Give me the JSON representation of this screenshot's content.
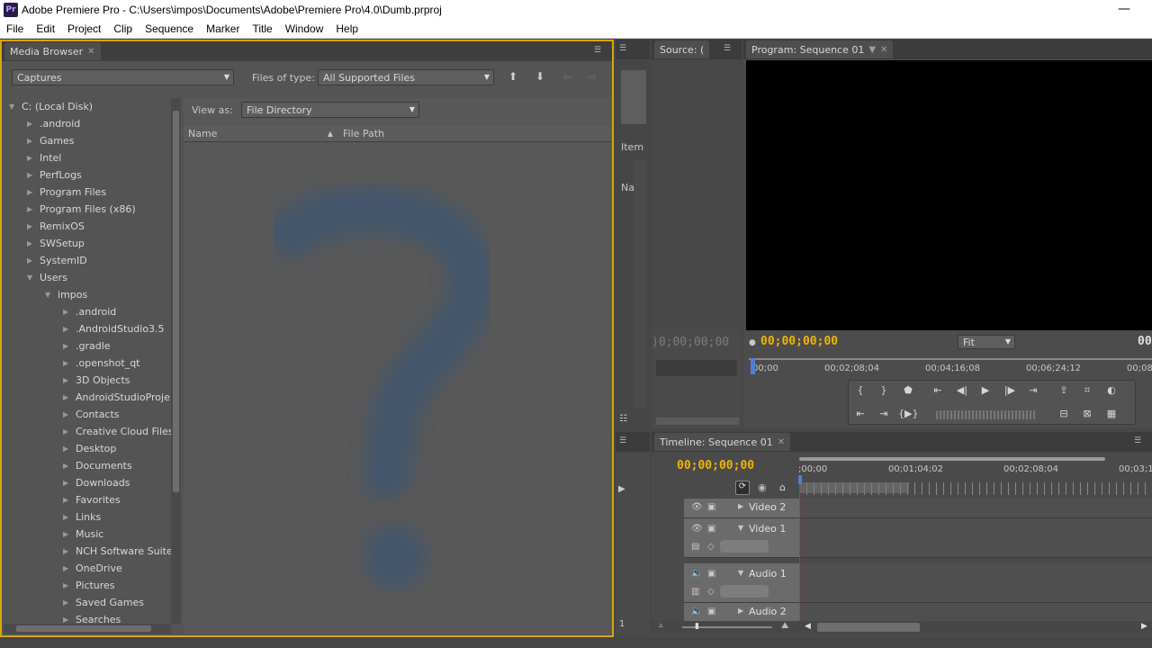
{
  "window": {
    "title": "Adobe Premiere Pro - C:\\Users\\impos\\Documents\\Adobe\\Premiere Pro\\4.0\\Dumb.prproj",
    "app_icon": "Pr",
    "minimize": "—"
  },
  "menu": [
    "File",
    "Edit",
    "Project",
    "Clip",
    "Sequence",
    "Marker",
    "Title",
    "Window",
    "Help"
  ],
  "media_browser": {
    "tab": "Media Browser",
    "location": "Captures",
    "files_of_type_label": "Files of type:",
    "files_of_type_value": "All Supported Files",
    "view_as_label": "View as:",
    "view_as_value": "File Directory",
    "columns": [
      "Name",
      "File Path"
    ],
    "tree": [
      {
        "label": "C: (Local Disk)",
        "level": 0,
        "expanded": true
      },
      {
        "label": ".android",
        "level": 1
      },
      {
        "label": "Games",
        "level": 1
      },
      {
        "label": "Intel",
        "level": 1
      },
      {
        "label": "PerfLogs",
        "level": 1
      },
      {
        "label": "Program Files",
        "level": 1
      },
      {
        "label": "Program Files (x86)",
        "level": 1
      },
      {
        "label": "RemixOS",
        "level": 1
      },
      {
        "label": "SWSetup",
        "level": 1
      },
      {
        "label": "SystemID",
        "level": 1
      },
      {
        "label": "Users",
        "level": 1,
        "expanded": true
      },
      {
        "label": "impos",
        "level": 2,
        "expanded": true
      },
      {
        "label": ".android",
        "level": 3
      },
      {
        "label": ".AndroidStudio3.5",
        "level": 3
      },
      {
        "label": ".gradle",
        "level": 3
      },
      {
        "label": ".openshot_qt",
        "level": 3
      },
      {
        "label": "3D Objects",
        "level": 3
      },
      {
        "label": "AndroidStudioProje",
        "level": 3
      },
      {
        "label": "Contacts",
        "level": 3
      },
      {
        "label": "Creative Cloud Files",
        "level": 3
      },
      {
        "label": "Desktop",
        "level": 3
      },
      {
        "label": "Documents",
        "level": 3
      },
      {
        "label": "Downloads",
        "level": 3
      },
      {
        "label": "Favorites",
        "level": 3
      },
      {
        "label": "Links",
        "level": 3
      },
      {
        "label": "Music",
        "level": 3
      },
      {
        "label": "NCH Software Suite",
        "level": 3
      },
      {
        "label": "OneDrive",
        "level": 3
      },
      {
        "label": "Pictures",
        "level": 3
      },
      {
        "label": "Saved Games",
        "level": 3
      },
      {
        "label": "Searches",
        "level": 3
      }
    ]
  },
  "project": {
    "item_label": "Item",
    "name_label": "Na",
    "count": "1"
  },
  "source": {
    "tab": "Source: (",
    "timecode": ")0;00;00;00"
  },
  "program": {
    "tab": "Program: Sequence 01",
    "timecode": "00;00;00;00",
    "fit": "Fit",
    "right_timecode": "00",
    "ruler_labels": [
      "00;00",
      "00;02;08;04",
      "00;04;16;08",
      "00;06;24;12",
      "00;08"
    ]
  },
  "timeline": {
    "tab": "Timeline: Sequence 01",
    "timecode": "00;00;00;00",
    "ruler_labels": [
      ";00;00",
      "00;01;04;02",
      "00;02;08;04",
      "00;03;1"
    ],
    "tracks": [
      "Video 2",
      "Video 1",
      "Audio 1",
      "Audio 2"
    ]
  },
  "colors": {
    "accent": "#f3b400",
    "focus_border": "#d9a70b",
    "playhead": "#d03030",
    "placeholder_question": "#3f5670"
  }
}
